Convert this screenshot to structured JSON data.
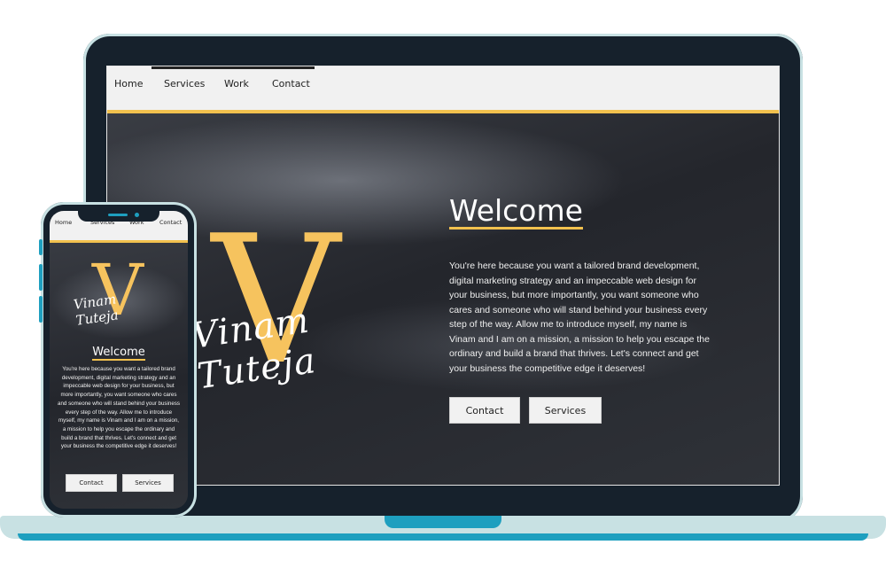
{
  "colors": {
    "accent": "#f2c14e",
    "device_frame": "#16212c",
    "device_trim": "#1e9fbf",
    "base": "#c8e1e3"
  },
  "desktop": {
    "nav": {
      "items": [
        "Home",
        "Services",
        "Work",
        "Contact"
      ]
    },
    "logo": {
      "letter": "V",
      "signature": "Vinam Tuteja"
    },
    "hero": {
      "title": "Welcome",
      "text": "You're here because you want a tailored brand development, digital marketing strategy and an impeccable web design for your business, but more importantly, you want someone who cares and someone who will stand behind your business every step of the way. Allow me to introduce myself, my name is Vinam and I am on a mission, a mission to help you escape the ordinary and build a brand that thrives. Let's connect and get your business the competitive edge it deserves!",
      "buttons": [
        "Contact",
        "Services"
      ]
    }
  },
  "mobile": {
    "nav": {
      "items": [
        "Home",
        "Services",
        "Work",
        "Contact"
      ]
    },
    "logo": {
      "letter": "V",
      "signature": "Vinam Tuteja"
    },
    "hero": {
      "title": "Welcome",
      "text": "You're here because you want a tailored brand development, digital marketing strategy and an impeccable web design for your business, but more importantly, you want someone who cares and someone who will stand behind your business every step of the way. Allow me to introduce myself, my name is Vinam and I am on a mission, a mission to help you escape the ordinary and build a brand that thrives. Let's connect and get your business the competitive edge it deserves!",
      "buttons": [
        "Contact",
        "Services"
      ]
    }
  }
}
